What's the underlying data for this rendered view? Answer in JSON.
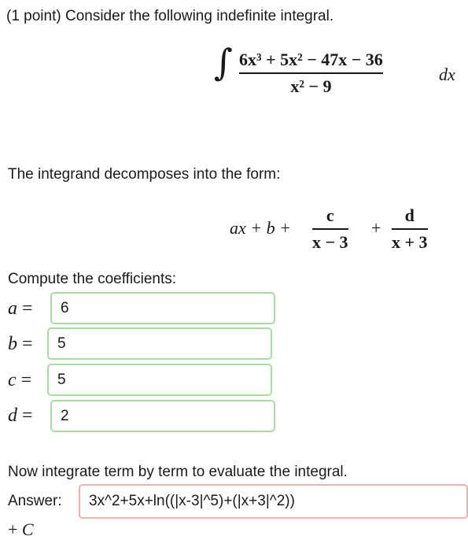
{
  "problem": {
    "intro": "(1 point) Consider the following indefinite integral.",
    "integral": {
      "numerator": "6x³ + 5x² − 47x − 36",
      "denominator": "x² − 9",
      "differential": "dx"
    },
    "decomp_intro": "The integrand decomposes into the form:",
    "form": {
      "lead": "ax + b +",
      "frac1_num": "c",
      "frac1_den": "x − 3",
      "plus": "+",
      "frac2_num": "d",
      "frac2_den": "x + 3"
    },
    "compute_label": "Compute the coefficients:",
    "coefficients": [
      {
        "var": "a",
        "value": "6"
      },
      {
        "var": "b",
        "value": "5"
      },
      {
        "var": "c",
        "value": "5"
      },
      {
        "var": "d",
        "value": "2"
      }
    ],
    "integrate_text": "Now integrate term by term to evaluate the integral.",
    "answer_label": "Answer:",
    "answer_value": "3x^2+5x+ln((|x-3|^5)+(|x+3|^2))",
    "constant": "+ C"
  },
  "colors": {
    "correct_border": "#a7dca3",
    "incorrect_border": "#f0b1b1"
  }
}
